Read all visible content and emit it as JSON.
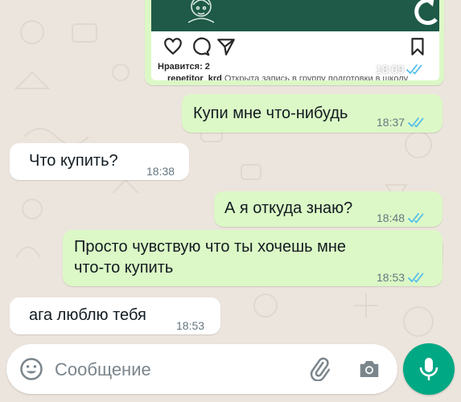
{
  "post": {
    "likes": "Нравится: 2",
    "author": "repetitor_krd",
    "caption_rest": "Открыта запись в группу подготовки в школу",
    "time": "18:09"
  },
  "messages": [
    {
      "direction": "outgoing",
      "text": "Купи мне что-нибудь",
      "time": "18:37",
      "status": "read"
    },
    {
      "direction": "incoming",
      "text": "Что купить?",
      "time": "18:38"
    },
    {
      "direction": "outgoing",
      "text": "А я откуда знаю?",
      "time": "18:48",
      "status": "read"
    },
    {
      "direction": "outgoing",
      "text_lines": [
        "Просто чувствую что ты хочешь мне",
        "что-то купить"
      ],
      "time": "18:53",
      "status": "read"
    },
    {
      "direction": "incoming",
      "text": "ага люблю тебя",
      "time": "18:53"
    }
  ],
  "composer": {
    "placeholder": "Сообщение"
  },
  "icons": {
    "emoji": "emoji-icon",
    "attach": "paperclip-icon",
    "camera": "camera-icon",
    "send": "microphone-icon"
  },
  "colors": {
    "chat_background": "#ece5dd",
    "outgoing_bubble": "#dcf8c6",
    "incoming_bubble": "#ffffff",
    "read_ticks": "#53bdeb",
    "mic_button": "#00a884"
  }
}
